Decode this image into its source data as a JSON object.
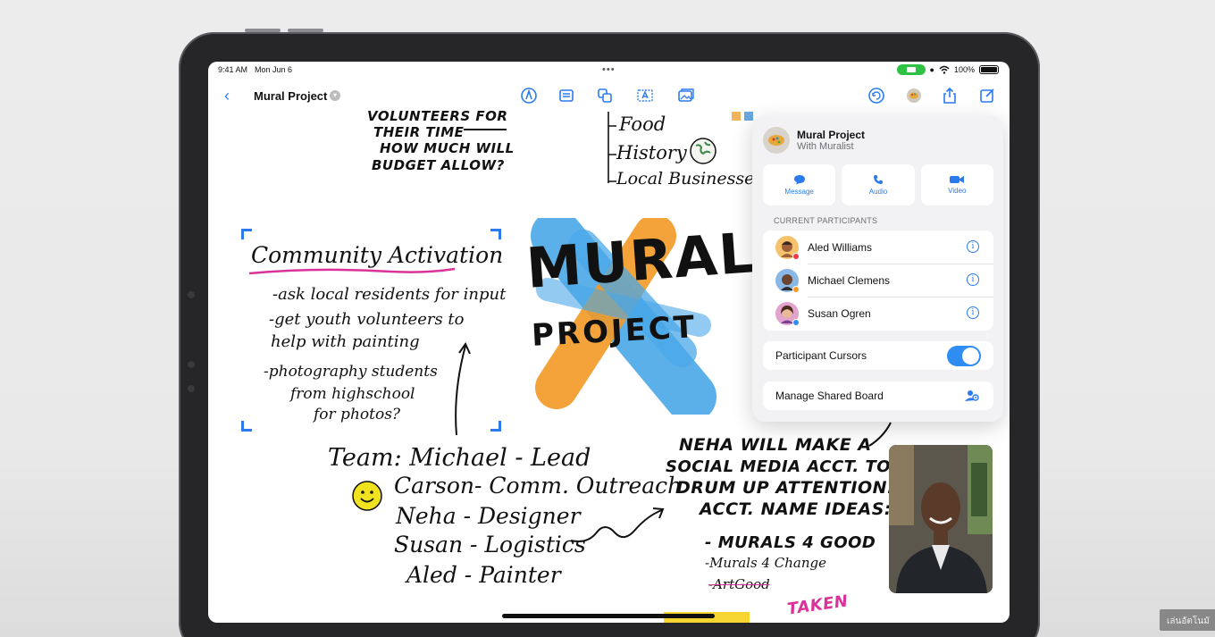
{
  "status": {
    "time": "9:41 AM",
    "date": "Mon Jun 6",
    "battery": "100%"
  },
  "toolbar": {
    "board_title": "Mural Project"
  },
  "canvas": {
    "top_questions": [
      "VOLUNTEERS FOR",
      "THEIR TIME",
      "HOW MUCH WILL",
      "BUDGET ALLOW?"
    ],
    "topics": [
      "Food",
      "History",
      "Local Businesses"
    ],
    "activation_title": "Community Activation",
    "activation_items": [
      "-ask local residents for input",
      "-get youth volunteers to",
      "help with painting",
      "-photography students",
      "from highschool",
      "for photos?"
    ],
    "mural_word1": "MURAL",
    "mural_word2": "PROJECT",
    "team_lines": [
      "Team: Michael - Lead",
      "Carson- Comm. Outreach",
      "Neha - Designer",
      "Susan - Logistics",
      "Aled - Painter"
    ],
    "neha_lines": [
      "NEHA WILL MAKE A",
      "SOCIAL MEDIA ACCT. TO",
      "DRUM UP ATTENTION.",
      "ACCT. NAME IDEAS:"
    ],
    "ideas": [
      "- MURALS 4 GOOD",
      "-Murals 4 Change",
      "-ArtGood"
    ],
    "taken": "TAKEN"
  },
  "share": {
    "title": "Mural Project",
    "subtitle": "With Muralist",
    "actions": [
      {
        "label": "Message"
      },
      {
        "label": "Audio"
      },
      {
        "label": "Video"
      }
    ],
    "section_label": "CURRENT PARTICIPANTS",
    "participants": [
      {
        "name": "Aled Williams",
        "dot_color": "#f0394a",
        "avatar_color": "#f6c26b"
      },
      {
        "name": "Michael Clemens",
        "dot_color": "#f49a2b",
        "avatar_color": "#8ab8e6"
      },
      {
        "name": "Susan Ogren",
        "dot_color": "#2f8df1",
        "avatar_color": "#e3a3cf"
      }
    ],
    "cursors_label": "Participant Cursors",
    "cursors_on": true,
    "manage_label": "Manage Shared Board"
  },
  "watermark": "เล่นอัตโนมั",
  "colors": {
    "accent": "#2b7bef",
    "mural_blue": "#4aa8e8",
    "mural_orange": "#f29a24",
    "highlight_pink": "#d9339a"
  }
}
